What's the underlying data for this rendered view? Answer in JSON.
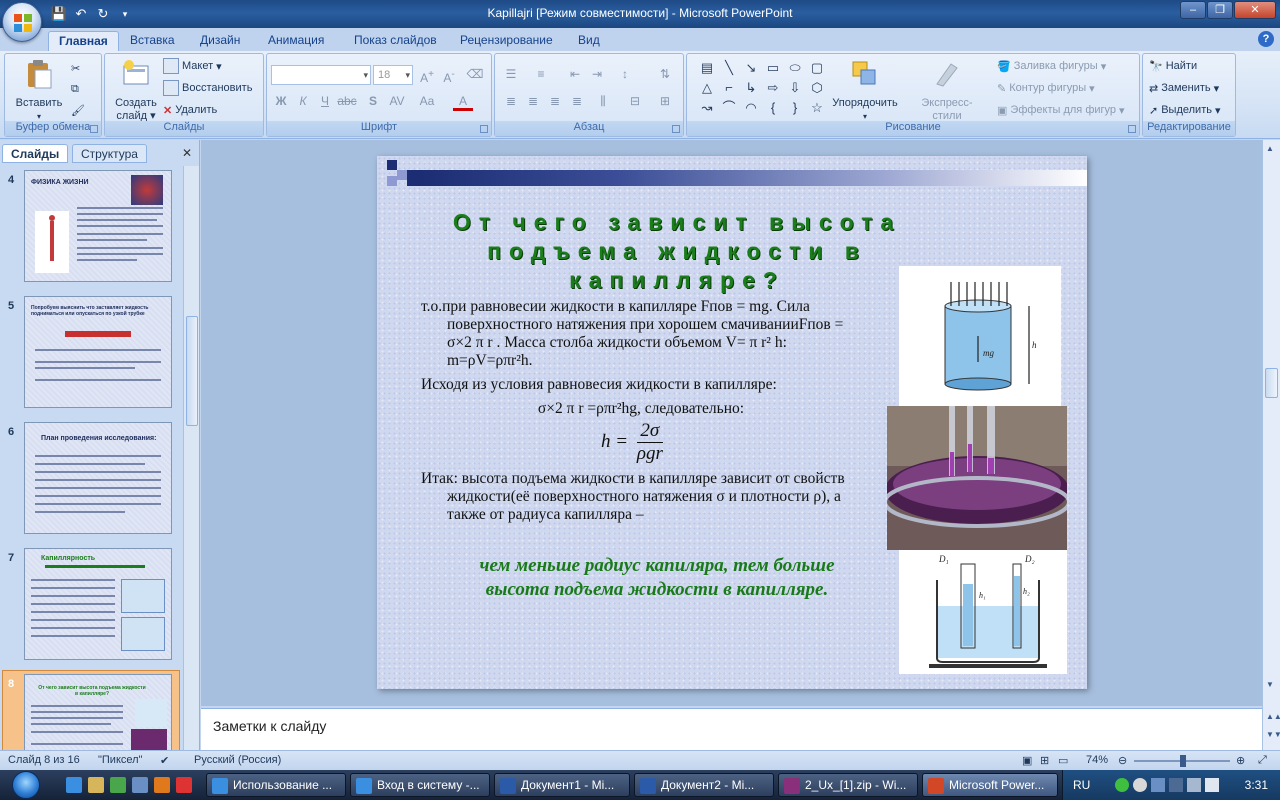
{
  "window": {
    "title": "Kapillajri [Режим совместимости] - Microsoft PowerPoint"
  },
  "ribbon": {
    "tabs": [
      "Главная",
      "Вставка",
      "Дизайн",
      "Анимация",
      "Показ слайдов",
      "Рецензирование",
      "Вид"
    ],
    "clipboard": {
      "paste": "Вставить",
      "label": "Буфер обмена"
    },
    "slides": {
      "create": "Создать слайд",
      "layout": "Макет",
      "reset": "Восстановить",
      "delete": "Удалить",
      "label": "Слайды"
    },
    "font": {
      "size": "18",
      "label": "Шрифт"
    },
    "paragraph": {
      "label": "Абзац"
    },
    "drawing": {
      "arrange": "Упорядочить",
      "styles": "Экспресс-стили",
      "fill": "Заливка фигуры",
      "outline": "Контур фигуры",
      "effects": "Эффекты для фигур",
      "label": "Рисование"
    },
    "editing": {
      "find": "Найти",
      "replace": "Заменить",
      "select": "Выделить",
      "label": "Редактирование"
    }
  },
  "panel": {
    "tab_slides": "Слайды",
    "tab_outline": "Структура"
  },
  "thumbnails": [
    {
      "num": "4",
      "title": "ФИЗИКА ЖИЗНИ"
    },
    {
      "num": "5",
      "title": "Попробуем выяснить что заставляет жидкость подниматься или опускаться по узкой трубке"
    },
    {
      "num": "6",
      "title": "План проведения исследования:"
    },
    {
      "num": "7",
      "title": "Капиллярность"
    },
    {
      "num": "8",
      "title": "От чего зависит высота подъема жидкости в капилляре?"
    }
  ],
  "slide": {
    "title": "От чего зависит высота подъема жидкости в капилляре?",
    "p1": "т.о.при равновесии жидкости в капилляре Fпов = mg. Сила поверхностного натяжения при хорошем смачиванииFпов = σ×2 π r . Масса столба жидкости объемом V= π r² h:    m=ρV=ρπr²h.",
    "p2": "Исходя из условия равновесия жидкости в капилляре:",
    "p3": "σ×2 π r =ρπr²hg, следовательно:",
    "formula_h": "h =",
    "formula_num": "2σ",
    "formula_den": "ρgr",
    "p4": "Итак: высота подъема жидкости в капилляре зависит от свойств жидкости(её поверхностного натяжения σ и плотности ρ), а также от радиуса капилляра –",
    "conclusion": "чем меньше радиус капиляра, тем больше высота подъема жидкости в капилляре."
  },
  "notes": {
    "text": "Заметки к слайду"
  },
  "status": {
    "slide": "Слайд 8 из 16",
    "theme": "\"Пиксел\"",
    "lang": "Русский (Россия)",
    "zoom": "74%"
  },
  "taskbar": {
    "items": [
      "Использование ...",
      "Вход в систему -...",
      "Документ1 - Mi...",
      "Документ2 - Mi...",
      "2_Ux_[1].zip - Wi...",
      "Microsoft Power..."
    ],
    "lang": "RU",
    "time": "3:31"
  }
}
